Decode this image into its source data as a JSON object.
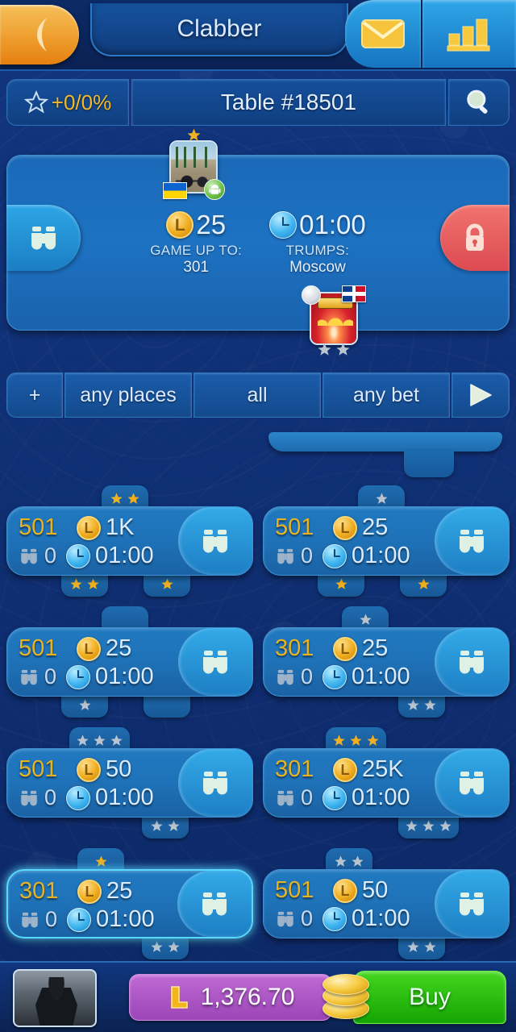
{
  "header": {
    "back_icon": "back-arrow-icon",
    "title": "Clabber",
    "mail_icon": "mail-envelope-icon",
    "stats_icon": "bar-chart-icon"
  },
  "search_row": {
    "star_icon": "star-outline-icon",
    "rating": "+0/0%",
    "table_label": "Table #18501",
    "search_icon": "search-magnifier-icon"
  },
  "featured": {
    "watch_icon": "binoculars-icon",
    "lock_icon": "padlock-icon",
    "bet_value": "25",
    "bet_icon": "gold-coin-icon",
    "time_value": "01:00",
    "time_icon": "clock-icon",
    "game_up_to_label": "GAME UP TO:",
    "game_up_to_value": "301",
    "trumps_label": "TRUMPS:",
    "trumps_value": "Moscow",
    "players": [
      {
        "seat": "top",
        "avatar_kind": "photo",
        "flag": "ua-flag-icon",
        "platform_badge": "android-icon",
        "stars": 1,
        "star_color": "gold"
      },
      {
        "seat": "bottom",
        "avatar_kind": "legend",
        "flag": "do-flag-icon",
        "rank_badge": "silver-circle-icon",
        "stars": 2,
        "star_color": "silver"
      }
    ]
  },
  "filter_bar": {
    "add_label": "+",
    "places_label": "any places",
    "all_label": "all",
    "bet_label": "any bet",
    "play_icon": "play-triangle-icon"
  },
  "tables": [
    {
      "goal": "501",
      "bet": "1K",
      "spectators": "0",
      "time": "01:00",
      "selected": false,
      "seats_top": [
        {
          "pos": 118,
          "stars": 2,
          "color": "gold"
        }
      ],
      "seats_bottom": [
        {
          "pos": 68,
          "stars": 2,
          "color": "gold"
        },
        {
          "pos": 170,
          "stars": 1,
          "color": "gold"
        }
      ]
    },
    {
      "goal": "501",
      "bet": "25",
      "spectators": "0",
      "time": "01:00",
      "selected": false,
      "seats_top": [
        {
          "pos": 118,
          "stars": 1,
          "color": "silver"
        }
      ],
      "seats_bottom": [
        {
          "pos": 68,
          "stars": 1,
          "color": "gold"
        },
        {
          "pos": 170,
          "stars": 1,
          "color": "gold"
        }
      ]
    },
    {
      "goal": "501",
      "bet": "25",
      "spectators": "0",
      "time": "01:00",
      "selected": false,
      "seats_top": [
        {
          "pos": 118,
          "stars": 0,
          "color": "none"
        }
      ],
      "seats_bottom": [
        {
          "pos": 68,
          "stars": 1,
          "color": "silver"
        },
        {
          "pos": 170,
          "stars": 0,
          "color": "none"
        }
      ]
    },
    {
      "goal": "301",
      "bet": "25",
      "spectators": "0",
      "time": "01:00",
      "selected": false,
      "seats_top": [
        {
          "pos": 98,
          "stars": 1,
          "color": "silver"
        }
      ],
      "seats_bottom": [
        {
          "pos": 168,
          "stars": 2,
          "color": "silver"
        }
      ]
    },
    {
      "goal": "501",
      "bet": "50",
      "spectators": "0",
      "time": "01:00",
      "selected": false,
      "seats_top": [
        {
          "pos": 78,
          "stars": 3,
          "color": "silver"
        }
      ],
      "seats_bottom": [
        {
          "pos": 168,
          "stars": 2,
          "color": "silver"
        }
      ]
    },
    {
      "goal": "301",
      "bet": "25K",
      "spectators": "0",
      "time": "01:00",
      "selected": false,
      "seats_top": [
        {
          "pos": 78,
          "stars": 3,
          "color": "gold"
        }
      ],
      "seats_bottom": [
        {
          "pos": 168,
          "stars": 3,
          "color": "silver"
        }
      ]
    },
    {
      "goal": "301",
      "bet": "25",
      "spectators": "0",
      "time": "01:00",
      "selected": true,
      "seats_top": [
        {
          "pos": 88,
          "stars": 1,
          "color": "gold"
        }
      ],
      "seats_bottom": [
        {
          "pos": 168,
          "stars": 2,
          "color": "silver"
        }
      ]
    },
    {
      "goal": "501",
      "bet": "50",
      "spectators": "0",
      "time": "01:00",
      "selected": false,
      "seats_top": [
        {
          "pos": 78,
          "stars": 2,
          "color": "silver"
        }
      ],
      "seats_bottom": [
        {
          "pos": 168,
          "stars": 2,
          "color": "silver"
        }
      ]
    }
  ],
  "bottom_bar": {
    "avatar": "batman-avatar-image",
    "currency_icon": "L-coin-icon",
    "balance": "1,376.70",
    "coins_icon": "coin-stack-icon",
    "buy_label": "Buy"
  },
  "colors": {
    "gold": "#f0b01f",
    "silver": "#b9c4cf",
    "accent_cyan": "#33aae8",
    "goal_text": "#e8b323",
    "bg_blue": "#10337a",
    "buy_green": "#2cc40f",
    "balance_purple": "#a852c4",
    "lock_red": "#e3565a"
  }
}
